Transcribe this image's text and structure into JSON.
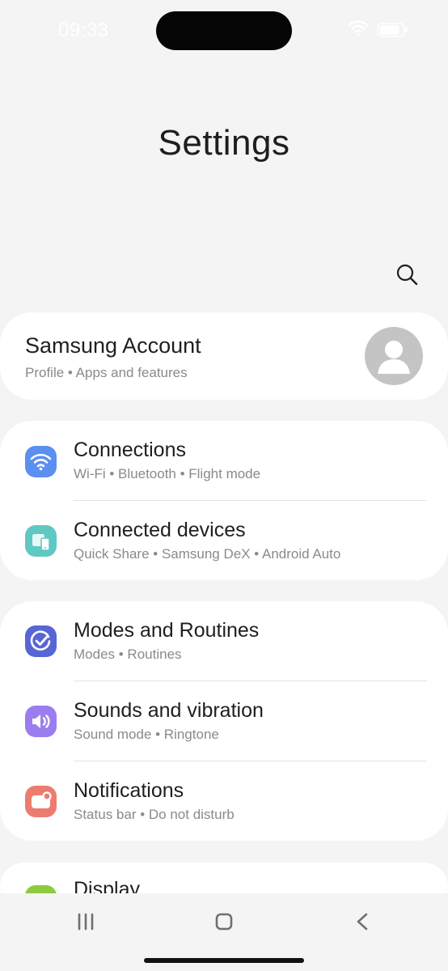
{
  "status_bar": {
    "time": "09:33",
    "wifi_icon": "wifi-icon",
    "battery_icon": "battery-icon"
  },
  "page": {
    "title": "Settings",
    "search_icon": "search-icon"
  },
  "account": {
    "name": "Samsung Account",
    "subtitle": "Profile  •  Apps and features",
    "avatar_icon": "person-avatar-icon"
  },
  "groups": [
    {
      "items": [
        {
          "title": "Connections",
          "subtitle": "Wi-Fi  •  Bluetooth  •  Flight mode",
          "icon": "wifi-icon",
          "icon_color": "#5b8ff0"
        },
        {
          "title": "Connected devices",
          "subtitle": "Quick Share  •  Samsung DeX  •  Android Auto",
          "icon": "connected-devices-icon",
          "icon_color": "#5ec9c2"
        }
      ]
    },
    {
      "items": [
        {
          "title": "Modes and Routines",
          "subtitle": "Modes  •  Routines",
          "icon": "modes-check-icon",
          "icon_color": "#5865d4"
        },
        {
          "title": "Sounds and vibration",
          "subtitle": "Sound mode  •  Ringtone",
          "icon": "speaker-icon",
          "icon_color": "#9b7df0"
        },
        {
          "title": "Notifications",
          "subtitle": "Status bar  •  Do not disturb",
          "icon": "notification-icon",
          "icon_color": "#ec7c6f"
        }
      ]
    },
    {
      "items": [
        {
          "title": "Display",
          "icon": "display-icon",
          "icon_color": "#8ccb3e"
        }
      ]
    }
  ],
  "nav": {
    "recents_icon": "recents-icon",
    "home_icon": "home-icon",
    "back_icon": "back-icon"
  }
}
